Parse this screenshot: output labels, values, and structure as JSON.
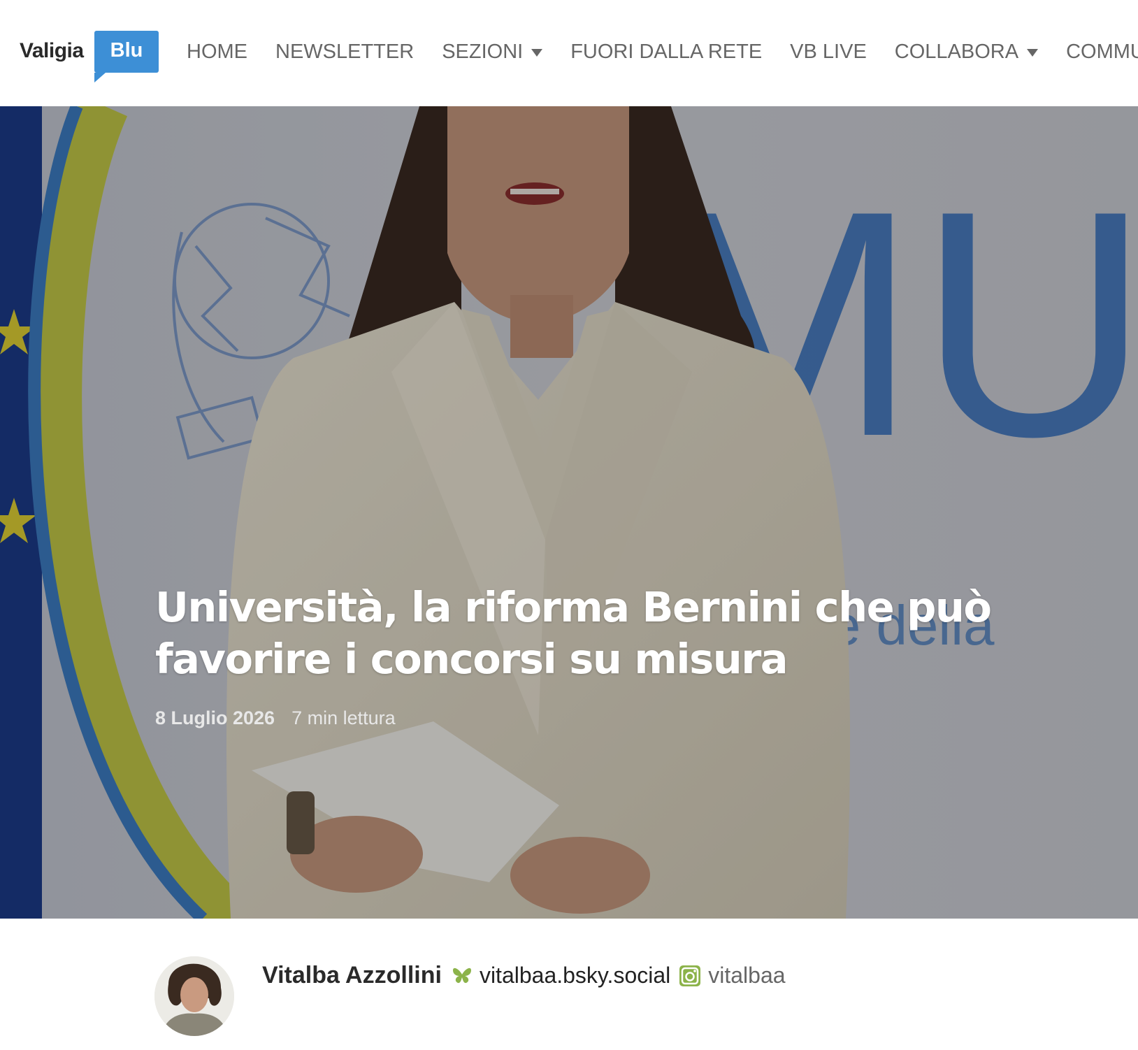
{
  "header": {
    "logo": {
      "text": "Valigia",
      "badge": "Blu"
    },
    "nav": [
      {
        "label": "HOME",
        "has_dropdown": false
      },
      {
        "label": "NEWSLETTER",
        "has_dropdown": false
      },
      {
        "label": "SEZIONI",
        "has_dropdown": true
      },
      {
        "label": "FUORI DALLA RETE",
        "has_dropdown": false
      },
      {
        "label": "VB LIVE",
        "has_dropdown": false
      },
      {
        "label": "COLLABORA",
        "has_dropdown": true
      },
      {
        "label": "COMMUNIT",
        "has_dropdown": false
      }
    ]
  },
  "hero": {
    "title": "Università, la riforma Bernini che può favorire i concorsi su misura",
    "date": "8 Luglio 2026",
    "read_time": "7 min lettura",
    "background_lettering": "MU"
  },
  "author": {
    "name": "Vitalba Azzollini",
    "bluesky_handle": "vitalbaa.bsky.social",
    "instagram_handle": "vitalbaa",
    "icons": {
      "bluesky": "butterfly-icon",
      "instagram": "instagram-icon"
    }
  },
  "colors": {
    "brand_blue": "#3d8fd6",
    "nav_text": "#666666",
    "social_green": "#8cb34a"
  }
}
